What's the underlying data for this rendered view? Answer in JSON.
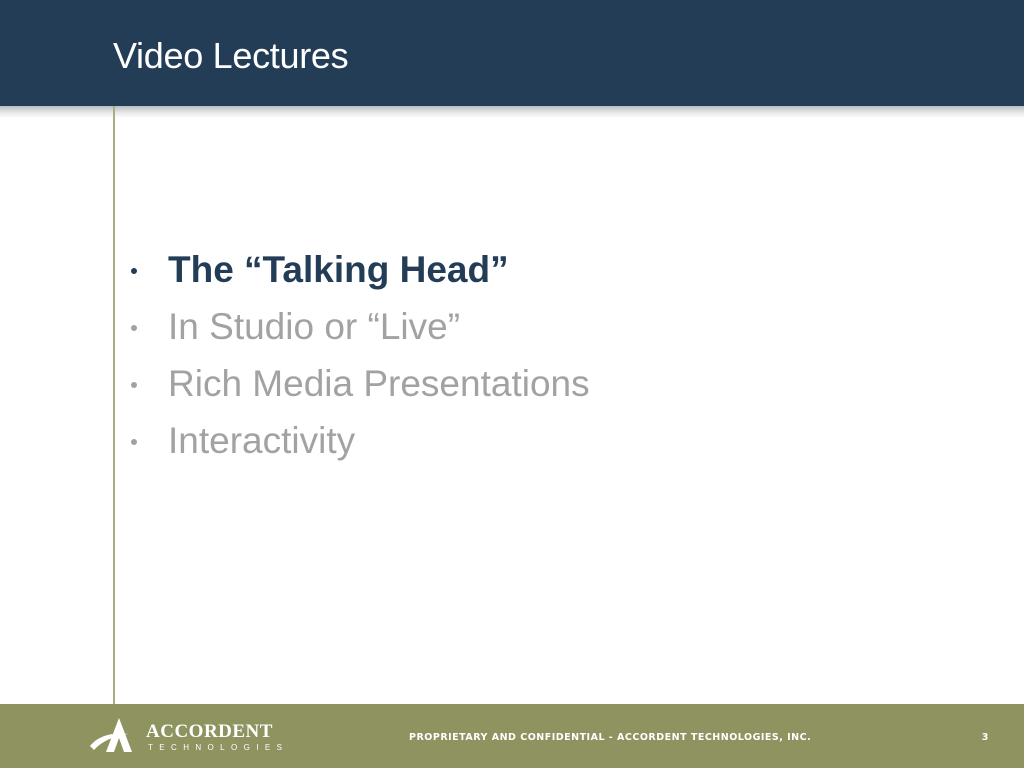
{
  "slide": {
    "title": "Video Lectures",
    "bullets": [
      {
        "text": "The “Talking Head”",
        "highlighted": true
      },
      {
        "text": "In Studio or “Live”",
        "highlighted": false
      },
      {
        "text": "Rich Media Presentations",
        "highlighted": false
      },
      {
        "text": "Interactivity",
        "highlighted": false
      }
    ]
  },
  "footer": {
    "logo_name": "ACCORDENT",
    "logo_subtitle": "TECHNOLOGIES",
    "confidential_text": "PROPRIETARY AND CONFIDENTIAL - ACCORDENT TECHNOLOGIES, INC.",
    "page_number": "3"
  },
  "icons": {
    "logo_mark": "accordent-logo-icon",
    "bullet": "bullet-dot-icon"
  },
  "colors": {
    "header_background": "#243d57",
    "footer_background": "#8f9360",
    "highlighted_text": "#243d57",
    "muted_text": "#a2a2a2",
    "divider_line": "#a9ad86"
  }
}
